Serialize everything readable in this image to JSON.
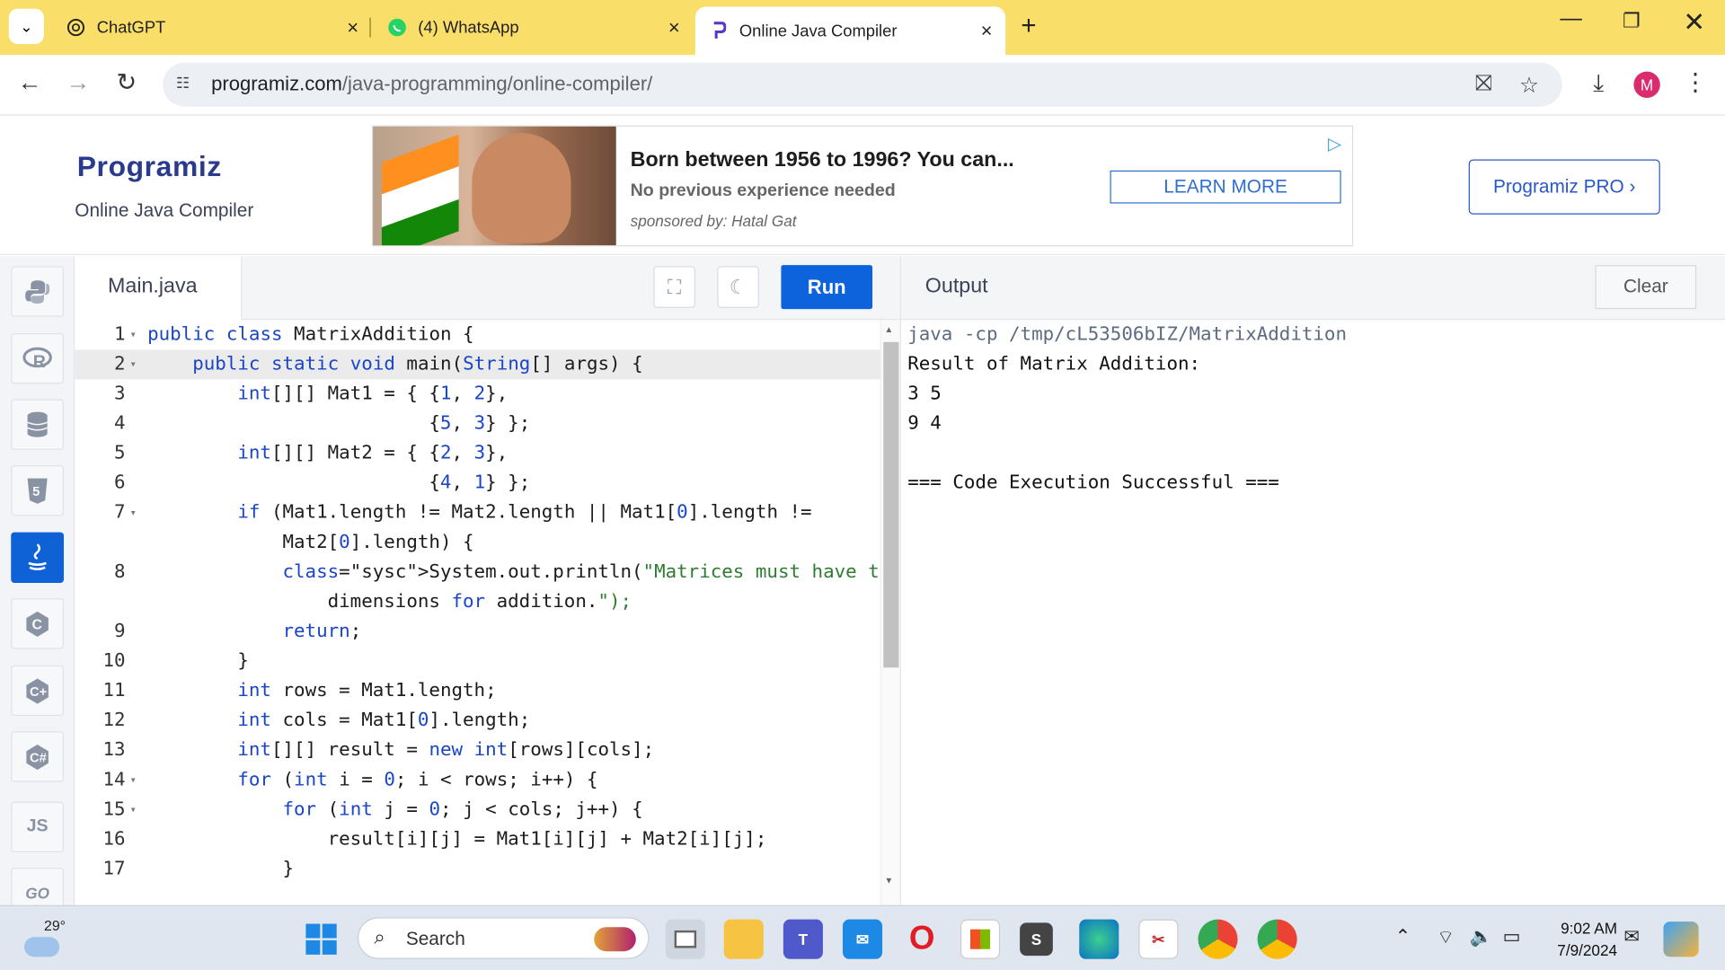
{
  "browser": {
    "tabs": [
      {
        "title": "ChatGPT",
        "icon": "chatgpt-icon"
      },
      {
        "title": "(4) WhatsApp",
        "icon": "whatsapp-icon"
      },
      {
        "title": "Online Java Compiler",
        "icon": "programiz-icon",
        "active": true
      }
    ],
    "url_domain": "programiz.com",
    "url_path": "/java-programming/online-compiler/",
    "avatar_letter": "M"
  },
  "site": {
    "logo": "Programiz",
    "subtitle": "Online Java Compiler",
    "pro_button": "Programiz PRO ›"
  },
  "ad": {
    "title": "Born between 1956 to 1996? You can...",
    "subtitle": "No previous experience needed",
    "sponsor": "sponsored by: Hatal Gat",
    "button": "LEARN MORE"
  },
  "rail": [
    "python-icon",
    "r-icon",
    "sql-icon",
    "html-icon",
    "java-icon",
    "c-icon",
    "cpp-icon",
    "csharp-icon",
    "JS",
    "GO"
  ],
  "editor": {
    "file_name": "Main.java",
    "run_label": "Run",
    "lines": [
      {
        "n": "1",
        "fold": true,
        "text": "public class MatrixAddition {"
      },
      {
        "n": "2",
        "fold": true,
        "text": "    public static void main(String[] args) {",
        "highlight": true
      },
      {
        "n": "3",
        "text": "        int[][] Mat1 = { {1, 2},"
      },
      {
        "n": "4",
        "text": "                         {5, 3} };"
      },
      {
        "n": "5",
        "text": "        int[][] Mat2 = { {2, 3},"
      },
      {
        "n": "6",
        "text": "                         {4, 1} };"
      },
      {
        "n": "7",
        "fold": true,
        "text": "        if (Mat1.length != Mat2.length || Mat1[0].length !="
      },
      {
        "n": "",
        "text": "            Mat2[0].length) {"
      },
      {
        "n": "8",
        "text": "            System.out.println(\"Matrices must have the same"
      },
      {
        "n": "",
        "text": "                dimensions for addition.\");"
      },
      {
        "n": "9",
        "text": "            return;"
      },
      {
        "n": "10",
        "text": "        }"
      },
      {
        "n": "11",
        "text": "        int rows = Mat1.length;"
      },
      {
        "n": "12",
        "text": "        int cols = Mat1[0].length;"
      },
      {
        "n": "13",
        "text": "        int[][] result = new int[rows][cols];"
      },
      {
        "n": "14",
        "fold": true,
        "text": "        for (int i = 0; i < rows; i++) {"
      },
      {
        "n": "15",
        "fold": true,
        "text": "            for (int j = 0; j < cols; j++) {"
      },
      {
        "n": "16",
        "text": "                result[i][j] = Mat1[i][j] + Mat2[i][j];"
      },
      {
        "n": "17",
        "text": "            }"
      }
    ]
  },
  "output": {
    "title": "Output",
    "clear_label": "Clear",
    "lines": [
      "java -cp /tmp/cL53506bIZ/MatrixAddition",
      "Result of Matrix Addition:",
      "3 5",
      "9 4",
      "",
      "=== Code Execution Successful ==="
    ]
  },
  "taskbar": {
    "weather": "29°",
    "search_label": "Search",
    "time": "9:02 AM",
    "date": "7/9/2024"
  }
}
